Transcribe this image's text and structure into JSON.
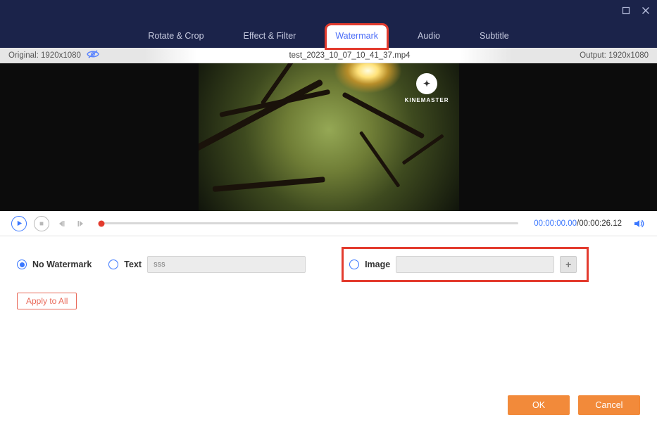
{
  "tabs": {
    "rotate": "Rotate & Crop",
    "effect": "Effect & Filter",
    "watermark": "Watermark",
    "audio": "Audio",
    "subtitle": "Subtitle"
  },
  "infobar": {
    "original_label": "Original: 1920x1080",
    "filename": "test_2023_10_07_10_41_37.mp4",
    "output_label": "Output: 1920x1080"
  },
  "preview": {
    "badge_top": "✦",
    "badge_text": "KINEMASTER"
  },
  "playback": {
    "current": "00:00:00.00",
    "total": "/00:00:26.12"
  },
  "watermark_options": {
    "none": "No Watermark",
    "text": "Text",
    "text_placeholder": "sss",
    "image": "Image",
    "add_symbol": "+"
  },
  "apply_all": "Apply to All",
  "footer": {
    "ok": "OK",
    "cancel": "Cancel"
  }
}
